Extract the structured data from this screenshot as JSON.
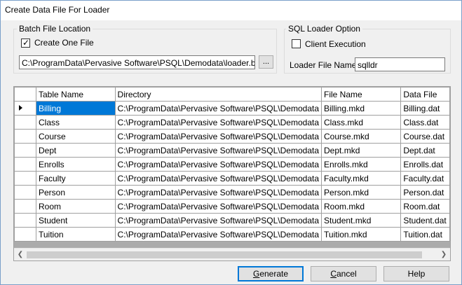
{
  "window": {
    "title": "Create Data File For Loader"
  },
  "batch_group": {
    "label": "Batch File Location",
    "create_one_file_label": "Create One File",
    "create_one_file_checked": true,
    "path_value": "C:\\ProgramData\\Pervasive Software\\PSQL\\Demodata\\loader.bat",
    "browse_label": "..."
  },
  "sql_group": {
    "label": "SQL Loader Option",
    "client_execution_label": "Client Execution",
    "client_execution_checked": false,
    "loader_file_name_label": "Loader File Name",
    "loader_file_name_value": "sqlldr"
  },
  "grid": {
    "columns": [
      "Table Name",
      "Directory",
      "File Name",
      "Data File"
    ],
    "rows": [
      {
        "table": "Billing",
        "dir": "C:\\ProgramData\\Pervasive Software\\PSQL\\Demodata",
        "file": "Billing.mkd",
        "data": "Billing.dat"
      },
      {
        "table": "Class",
        "dir": "C:\\ProgramData\\Pervasive Software\\PSQL\\Demodata",
        "file": "Class.mkd",
        "data": "Class.dat"
      },
      {
        "table": "Course",
        "dir": "C:\\ProgramData\\Pervasive Software\\PSQL\\Demodata",
        "file": "Course.mkd",
        "data": "Course.dat"
      },
      {
        "table": "Dept",
        "dir": "C:\\ProgramData\\Pervasive Software\\PSQL\\Demodata",
        "file": "Dept.mkd",
        "data": "Dept.dat"
      },
      {
        "table": "Enrolls",
        "dir": "C:\\ProgramData\\Pervasive Software\\PSQL\\Demodata",
        "file": "Enrolls.mkd",
        "data": "Enrolls.dat"
      },
      {
        "table": "Faculty",
        "dir": "C:\\ProgramData\\Pervasive Software\\PSQL\\Demodata",
        "file": "Faculty.mkd",
        "data": "Faculty.dat"
      },
      {
        "table": "Person",
        "dir": "C:\\ProgramData\\Pervasive Software\\PSQL\\Demodata",
        "file": "Person.mkd",
        "data": "Person.dat"
      },
      {
        "table": "Room",
        "dir": "C:\\ProgramData\\Pervasive Software\\PSQL\\Demodata",
        "file": "Room.mkd",
        "data": "Room.dat"
      },
      {
        "table": "Student",
        "dir": "C:\\ProgramData\\Pervasive Software\\PSQL\\Demodata",
        "file": "Student.mkd",
        "data": "Student.dat"
      },
      {
        "table": "Tuition",
        "dir": "C:\\ProgramData\\Pervasive Software\\PSQL\\Demodata",
        "file": "Tuition.mkd",
        "data": "Tuition.dat"
      }
    ],
    "selected_row": 0
  },
  "buttons": {
    "generate_label": "Generate",
    "cancel_label": "Cancel",
    "help_label": "Help"
  },
  "icons": {
    "current_row": "row-pointer-icon",
    "scroll_left": "chevron-left-icon",
    "scroll_right": "chevron-right-icon"
  },
  "colors": {
    "selection": "#0078d7",
    "default_button_border": "#0078d7"
  }
}
